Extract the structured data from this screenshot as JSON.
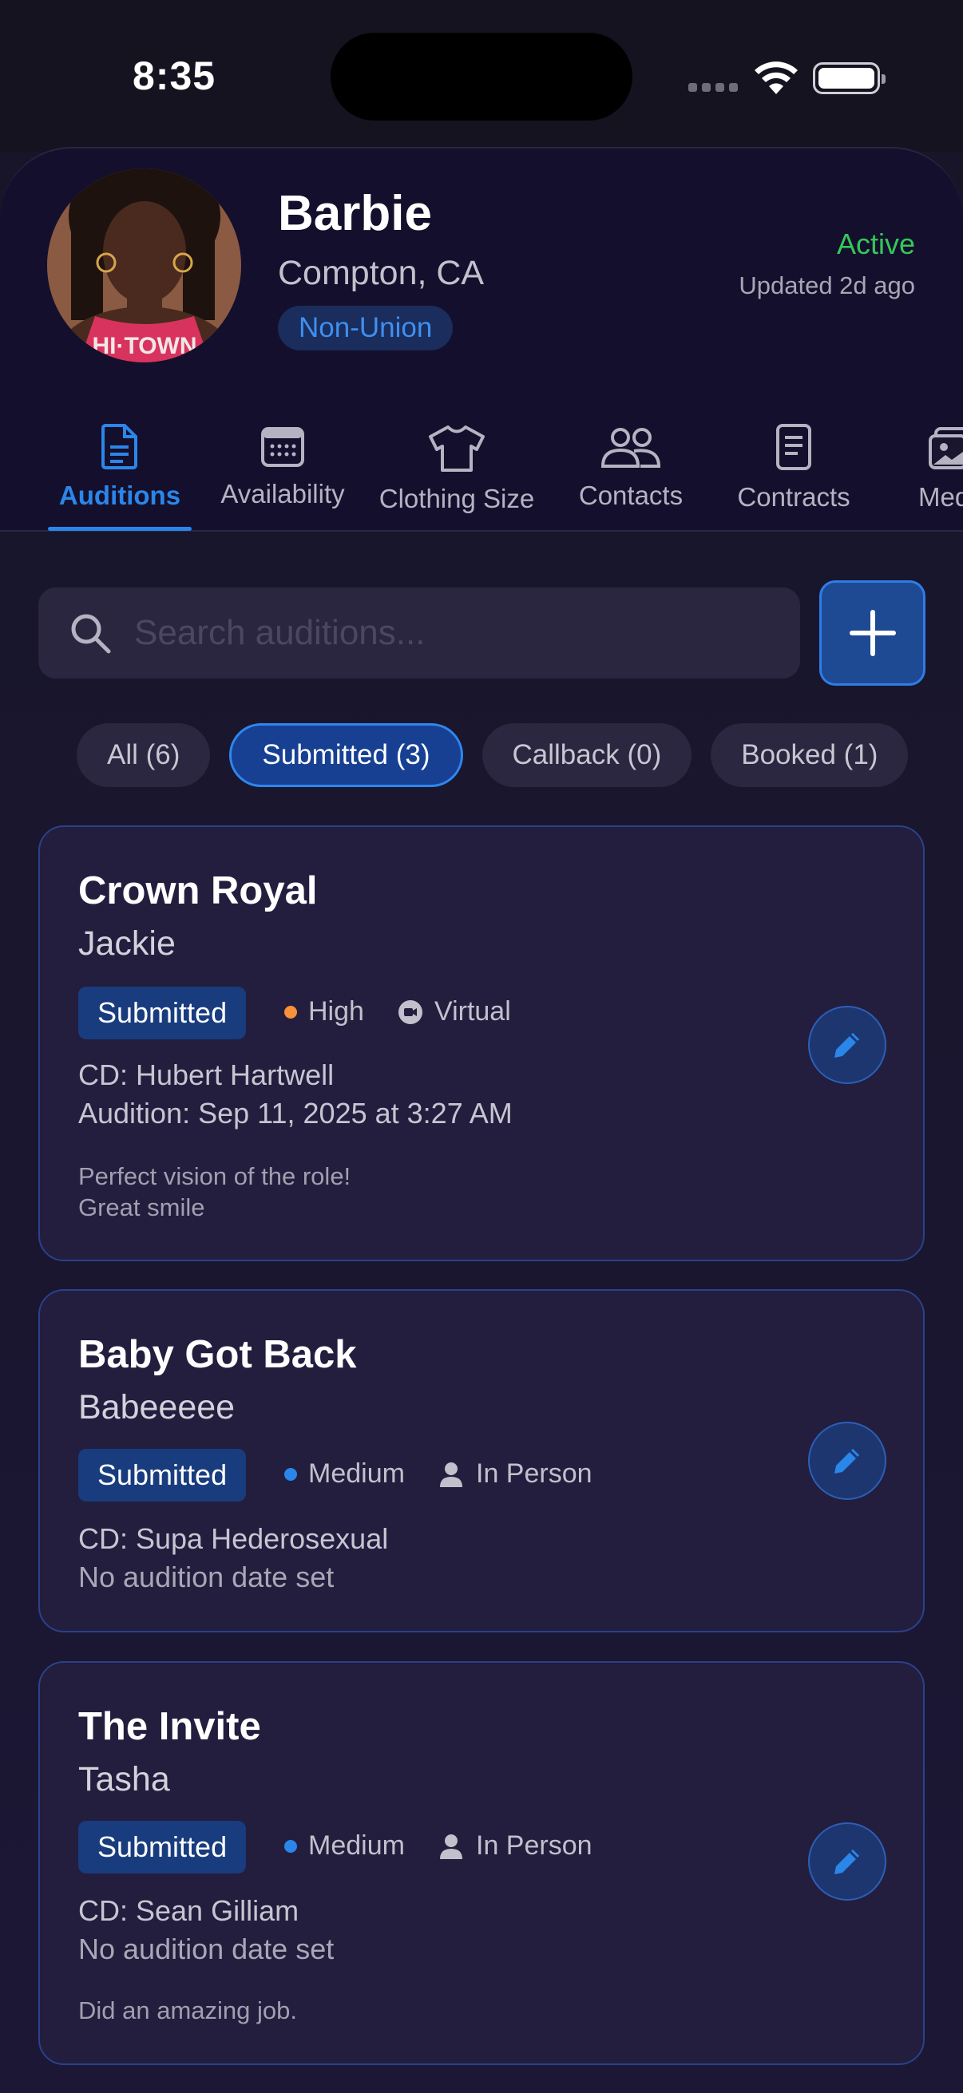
{
  "status_bar": {
    "time": "8:35"
  },
  "profile": {
    "name": "Barbie",
    "location": "Compton, CA",
    "union_status": "Non-Union",
    "status": "Active",
    "updated": "Updated 2d ago",
    "status_color": "#34c759"
  },
  "tabs": [
    {
      "label": "Auditions",
      "icon": "document-icon",
      "active": true
    },
    {
      "label": "Availability",
      "icon": "calendar-icon"
    },
    {
      "label": "Clothing Size",
      "icon": "shirt-icon"
    },
    {
      "label": "Contacts",
      "icon": "people-icon"
    },
    {
      "label": "Contracts",
      "icon": "contract-icon"
    },
    {
      "label": "Media",
      "icon": "photo-icon"
    }
  ],
  "search": {
    "placeholder": "Search auditions..."
  },
  "filters": [
    {
      "label": "All (6)"
    },
    {
      "label": "Submitted (3)",
      "selected": true
    },
    {
      "label": "Callback (0)"
    },
    {
      "label": "Booked (1)"
    }
  ],
  "auditions": [
    {
      "title": "Crown Royal",
      "role": "Jackie",
      "status": "Submitted",
      "priority": "High",
      "priority_color": "#f7913a",
      "location_type": "Virtual",
      "location_icon": "video-camera-icon",
      "casting_director": "CD: Hubert Hartwell",
      "audition_date": "Audition: Sep 11, 2025 at 3:27 AM",
      "notes_line1": "Perfect vision of the role!",
      "notes_line2": "Great smile"
    },
    {
      "title": "Baby Got Back",
      "role": "Babeeeee",
      "status": "Submitted",
      "priority": "Medium",
      "priority_color": "#2b86ea",
      "location_type": "In Person",
      "location_icon": "person-icon",
      "casting_director": "CD: Supa Hederosexual",
      "audition_date": "No audition date set"
    },
    {
      "title": "The Invite",
      "role": "Tasha",
      "status": "Submitted",
      "priority": "Medium",
      "priority_color": "#2b86ea",
      "location_type": "In Person",
      "location_icon": "person-icon",
      "casting_director": "CD: Sean Gilliam",
      "audition_date": "No audition date set",
      "notes_line1": "Did an amazing job."
    }
  ],
  "colors": {
    "accent": "#2b86ea",
    "background": "#161427"
  }
}
